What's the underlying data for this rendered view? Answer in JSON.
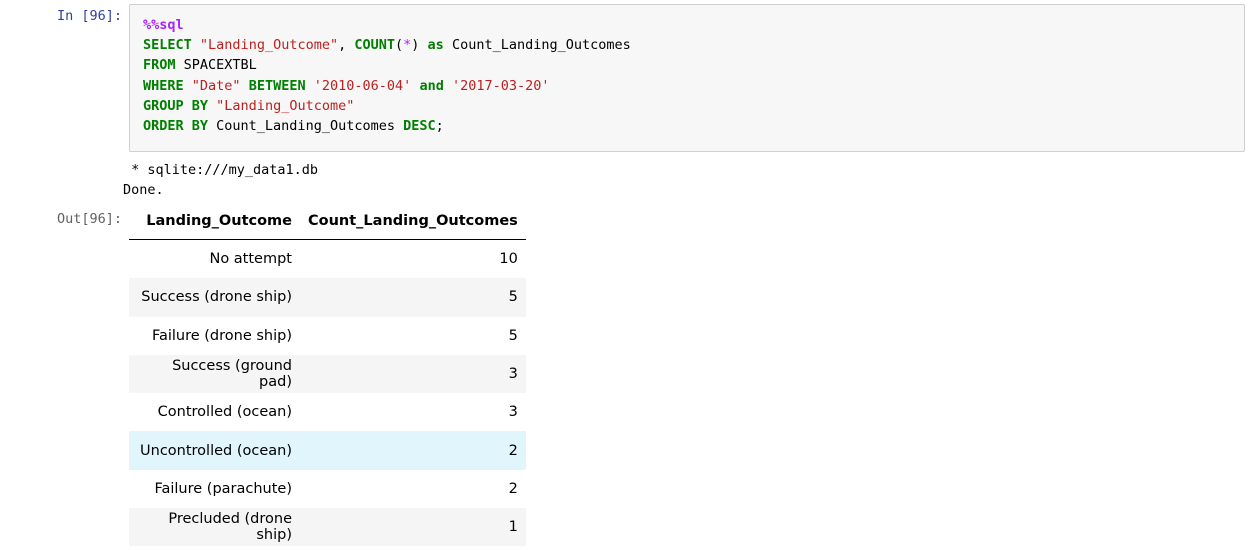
{
  "input_cell": {
    "prompt": "In [96]:",
    "code_lines": [
      [
        {
          "t": "%%sql",
          "c": "magic"
        }
      ],
      [
        {
          "t": "SELECT",
          "c": "kw"
        },
        {
          "t": " ",
          "c": ""
        },
        {
          "t": "\"Landing_Outcome\"",
          "c": "str"
        },
        {
          "t": ", ",
          "c": ""
        },
        {
          "t": "COUNT",
          "c": "kw"
        },
        {
          "t": "(",
          "c": ""
        },
        {
          "t": "*",
          "c": "op"
        },
        {
          "t": ") ",
          "c": ""
        },
        {
          "t": "as",
          "c": "kw"
        },
        {
          "t": " Count_Landing_Outcomes",
          "c": ""
        }
      ],
      [
        {
          "t": "FROM",
          "c": "kw"
        },
        {
          "t": " SPACEXTBL",
          "c": ""
        }
      ],
      [
        {
          "t": "WHERE",
          "c": "kw"
        },
        {
          "t": " ",
          "c": ""
        },
        {
          "t": "\"Date\"",
          "c": "str"
        },
        {
          "t": " ",
          "c": ""
        },
        {
          "t": "BETWEEN",
          "c": "kw"
        },
        {
          "t": " ",
          "c": ""
        },
        {
          "t": "'2010-06-04'",
          "c": "str"
        },
        {
          "t": " ",
          "c": ""
        },
        {
          "t": "and",
          "c": "kw"
        },
        {
          "t": " ",
          "c": ""
        },
        {
          "t": "'2017-03-20'",
          "c": "str"
        }
      ],
      [
        {
          "t": "GROUP BY",
          "c": "kw"
        },
        {
          "t": " ",
          "c": ""
        },
        {
          "t": "\"Landing_Outcome\"",
          "c": "str"
        }
      ],
      [
        {
          "t": "ORDER BY",
          "c": "kw"
        },
        {
          "t": " Count_Landing_Outcomes ",
          "c": ""
        },
        {
          "t": "DESC",
          "c": "kw"
        },
        {
          "t": ";",
          "c": ""
        }
      ]
    ]
  },
  "stdout_lines": [
    " * sqlite:///my_data1.db",
    "Done."
  ],
  "output_cell": {
    "prompt": "Out[96]:",
    "columns": [
      "Landing_Outcome",
      "Count_Landing_Outcomes"
    ],
    "rows": [
      [
        "No attempt",
        "10"
      ],
      [
        "Success (drone ship)",
        "5"
      ],
      [
        "Failure (drone ship)",
        "5"
      ],
      [
        "Success (ground pad)",
        "3"
      ],
      [
        "Controlled (ocean)",
        "3"
      ],
      [
        "Uncontrolled (ocean)",
        "2"
      ],
      [
        "Failure (parachute)",
        "2"
      ],
      [
        "Precluded (drone ship)",
        "1"
      ]
    ],
    "hovered_row_index": 5
  },
  "colors": {
    "keyword": "#008000",
    "string": "#ba2121",
    "magic": "#aa22ff",
    "in_prompt": "#303f9f",
    "out_prompt": "#616161",
    "hover_row": "#e1f5fd",
    "striped_row": "#f5f5f5"
  }
}
